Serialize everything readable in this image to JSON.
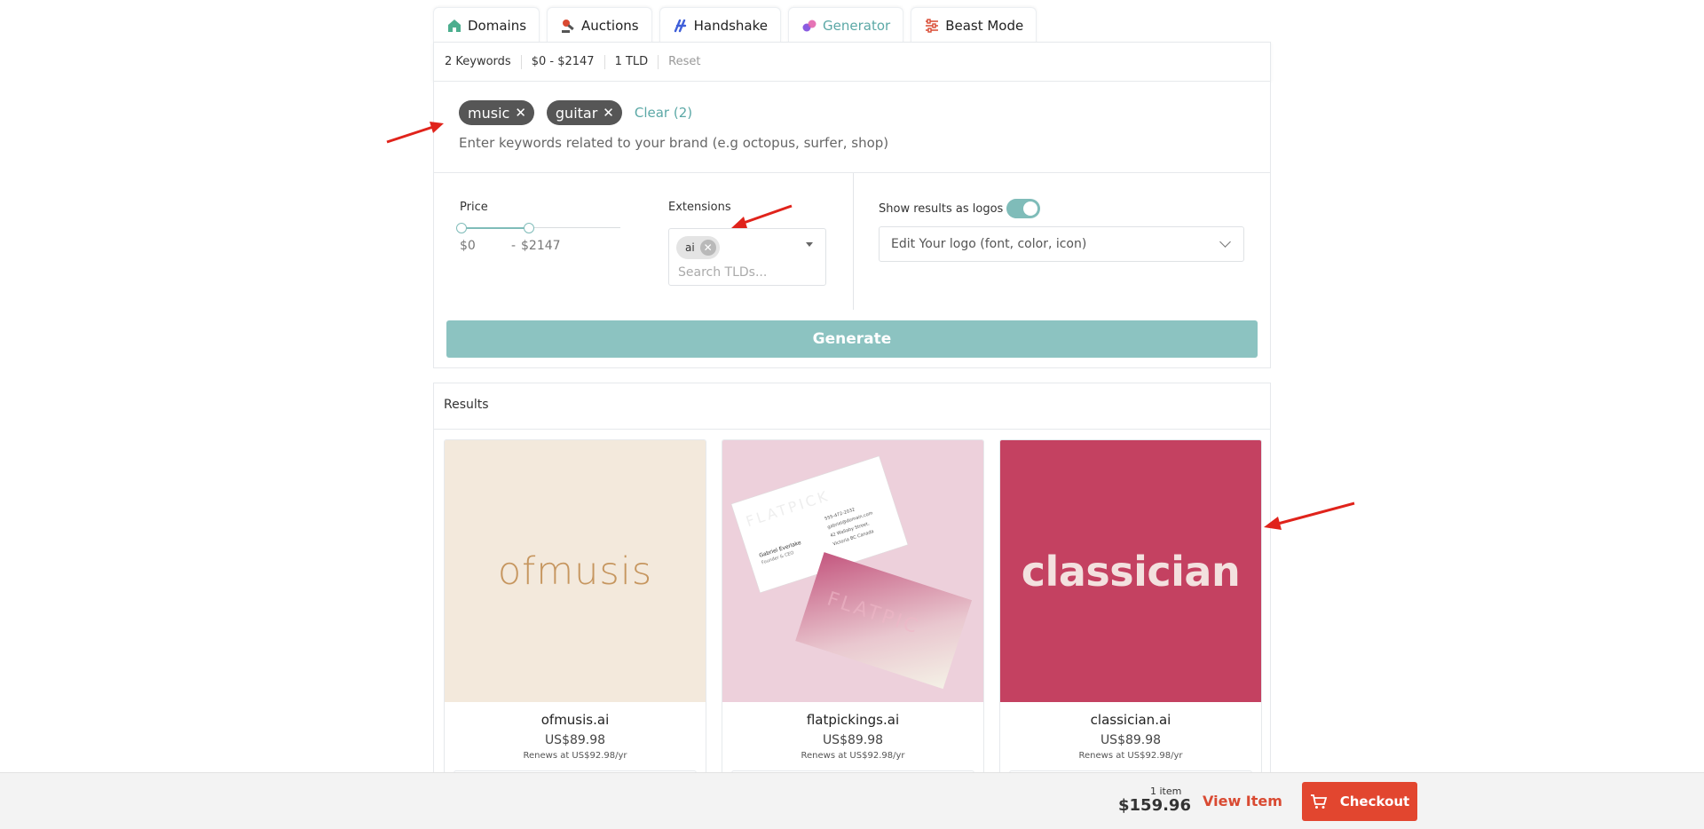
{
  "tabs": [
    {
      "label": "Domains",
      "icon": "house-icon",
      "color": "#4cae8e"
    },
    {
      "label": "Auctions",
      "icon": "auction-gavel-icon",
      "color": "#d94a32"
    },
    {
      "label": "Handshake",
      "icon": "handshake-icon",
      "color": "#3f5fd9"
    },
    {
      "label": "Generator",
      "icon": "generator-icon",
      "color": "#8a5ce0",
      "active": true
    },
    {
      "label": "Beast Mode",
      "icon": "sliders-icon",
      "color": "#d94a32"
    }
  ],
  "filters": {
    "keywords": "2 Keywords",
    "price_range": "$0 - $2147",
    "tld_count": "1 TLD",
    "reset": "Reset"
  },
  "keywords": {
    "chips": [
      "music",
      "guitar"
    ],
    "clear_label": "Clear (2)",
    "placeholder": "Enter keywords related to your brand (e.g octopus, surfer, shop)"
  },
  "price": {
    "label": "Price",
    "min": "$0",
    "sep": "-",
    "max": "$2147"
  },
  "extensions": {
    "label": "Extensions",
    "selected": "ai",
    "search_placeholder": "Search TLDs..."
  },
  "logos": {
    "toggle_label": "Show results as logos",
    "enabled": true,
    "select_label": "Edit Your logo (font, color, icon)"
  },
  "generate_label": "Generate",
  "results": {
    "title": "Results",
    "items": [
      {
        "domain": "ofmusis.ai",
        "price": "US$89.98",
        "renew": "Renews at US$92.98/yr",
        "logo_text": "ofmusis",
        "bg": "#f3e9dc"
      },
      {
        "domain": "flatpickings.ai",
        "price": "US$89.98",
        "renew": "Renews at US$92.98/yr",
        "bg": "#edd0db",
        "card": {
          "person": "Gabriel Everlake",
          "role": "Founder & CEO",
          "phone": "555-472-2032",
          "email": "gabriel@domain.com",
          "street": "42 Wallaby Street,",
          "city": "Victoria BC Canada"
        }
      },
      {
        "domain": "classician.ai",
        "price": "US$89.98",
        "renew": "Renews at US$92.98/yr",
        "logo_text": "classician",
        "bg": "#c44161"
      }
    ]
  },
  "cart": {
    "count": "1 item",
    "total": "$159.96",
    "view_label": "View Item",
    "checkout_label": "Checkout"
  }
}
